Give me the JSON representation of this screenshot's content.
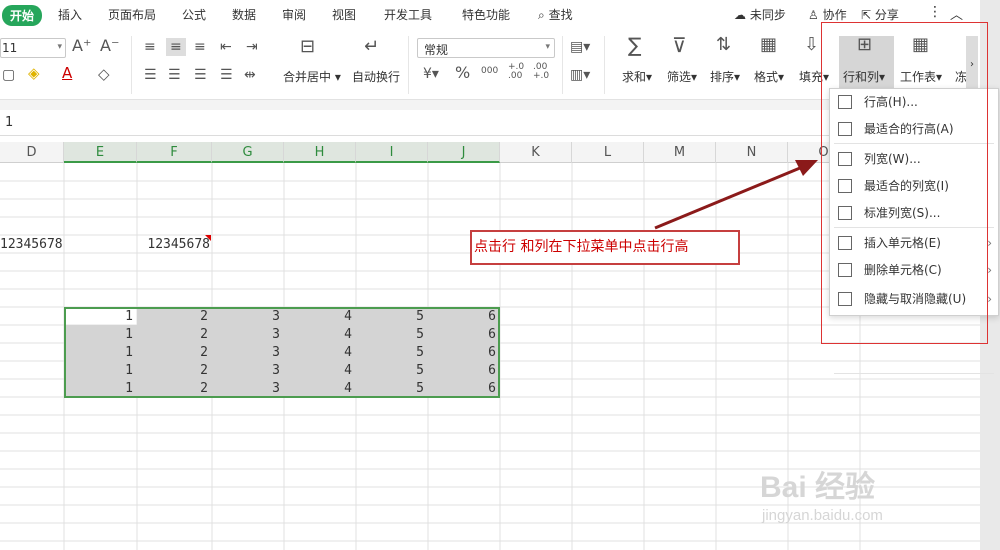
{
  "tabs": [
    "开始",
    "插入",
    "页面布局",
    "公式",
    "数据",
    "审阅",
    "视图",
    "开发工具",
    "特色功能"
  ],
  "search_label": "查找",
  "right_actions": {
    "sync": "未同步",
    "collab": "协作",
    "share": "分享"
  },
  "ribbon": {
    "font_size": "11",
    "number_format": "常规",
    "merge_label": "合并居中",
    "wrap_label": "自动换行",
    "sum_label": "求和",
    "filter_label": "筛选",
    "sort_label": "排序",
    "format_label": "格式",
    "fill_label": "填充",
    "rowcol_label": "行和列",
    "sheet_label": "工作表",
    "freeze_label": "冻",
    "percent": "%",
    "thousand": "000",
    "inc_dec": "+.0 .00",
    "dec_dec": ".00 +.0"
  },
  "formula_value": "1",
  "columns": [
    "D",
    "E",
    "F",
    "G",
    "H",
    "I",
    "J",
    "K",
    "L",
    "M",
    "N",
    "O"
  ],
  "cells": {
    "d_value": "12345678",
    "f_value": "12345678"
  },
  "table_rows": [
    [
      1,
      2,
      3,
      4,
      5,
      6
    ],
    [
      1,
      2,
      3,
      4,
      5,
      6
    ],
    [
      1,
      2,
      3,
      4,
      5,
      6
    ],
    [
      1,
      2,
      3,
      4,
      5,
      6
    ],
    [
      1,
      2,
      3,
      4,
      5,
      6
    ]
  ],
  "menu": [
    {
      "label": "行高(H)...",
      "arrow": ""
    },
    {
      "label": "最适合的行高(A)",
      "arrow": ""
    },
    {
      "label": "列宽(W)...",
      "arrow": ""
    },
    {
      "label": "最适合的列宽(I)",
      "arrow": ""
    },
    {
      "label": "标准列宽(S)...",
      "arrow": ""
    },
    {
      "label": "插入单元格(E)",
      "arrow": "›"
    },
    {
      "label": "删除单元格(C)",
      "arrow": "›"
    },
    {
      "label": "隐藏与取消隐藏(U)",
      "arrow": "›"
    }
  ],
  "annotation": "点击行 和列在下拉菜单中点击行高",
  "watermark": "Bai 经验",
  "watermark_url": "jingyan.baidu.com"
}
